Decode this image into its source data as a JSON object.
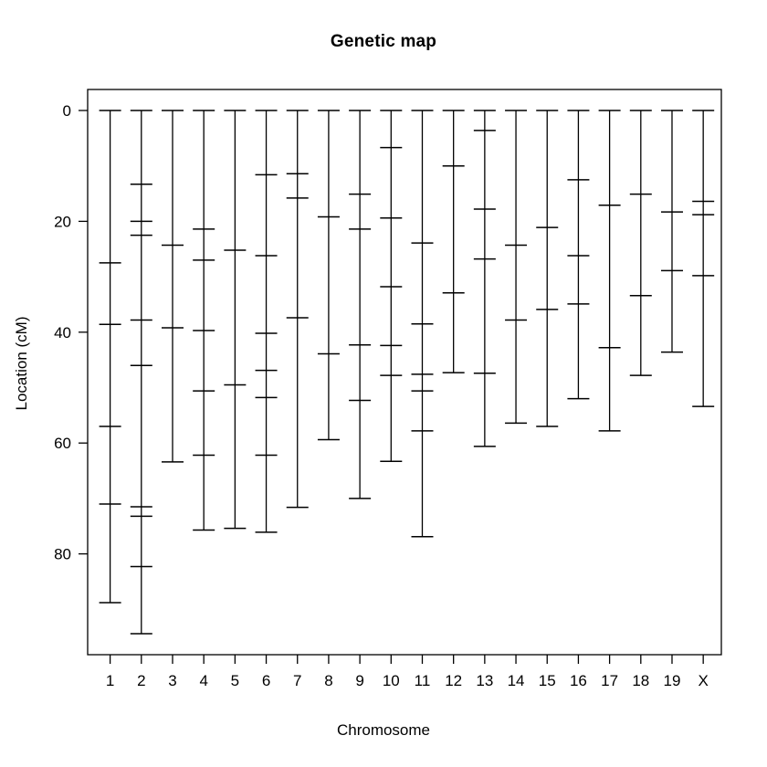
{
  "chart_data": {
    "type": "scatter",
    "title": "Genetic map",
    "xlabel": "Chromosome",
    "ylabel": "Location (cM)",
    "grid": false,
    "legend": null,
    "y_reversed": true,
    "ylim": [
      0,
      102
    ],
    "y_ticks": [
      0,
      20,
      40,
      60,
      80
    ],
    "y_tick_labels": [
      "0",
      "20",
      "40",
      "60",
      "80"
    ],
    "categories": [
      "1",
      "2",
      "3",
      "4",
      "5",
      "6",
      "7",
      "8",
      "9",
      "10",
      "11",
      "12",
      "13",
      "14",
      "15",
      "16",
      "17",
      "18",
      "19",
      "X"
    ],
    "series": [
      {
        "name": "1",
        "values": [
          0.0,
          27.5,
          38.6,
          57.0,
          71.0,
          88.8
        ]
      },
      {
        "name": "2",
        "values": [
          0.0,
          13.3,
          20.0,
          22.5,
          37.8,
          46.0,
          71.5,
          73.2,
          82.3,
          94.4
        ]
      },
      {
        "name": "3",
        "values": [
          0.0,
          24.3,
          39.2,
          63.4
        ]
      },
      {
        "name": "4",
        "values": [
          0.0,
          21.4,
          27.0,
          39.7,
          50.6,
          62.2,
          75.7
        ]
      },
      {
        "name": "5",
        "values": [
          0.0,
          25.2,
          49.5,
          75.4
        ]
      },
      {
        "name": "6",
        "values": [
          0.0,
          11.6,
          26.2,
          40.2,
          46.9,
          51.8,
          62.2,
          76.1
        ]
      },
      {
        "name": "7",
        "values": [
          0.0,
          11.4,
          15.8,
          37.4,
          71.6
        ]
      },
      {
        "name": "8",
        "values": [
          0.0,
          19.2,
          43.9,
          59.4
        ]
      },
      {
        "name": "9",
        "values": [
          0.0,
          15.1,
          21.4,
          42.3,
          52.3,
          70.0
        ]
      },
      {
        "name": "10",
        "values": [
          0.0,
          6.7,
          19.4,
          31.8,
          42.4,
          47.8,
          63.3
        ]
      },
      {
        "name": "11",
        "values": [
          0.0,
          23.9,
          38.5,
          47.6,
          50.6,
          57.8,
          76.9
        ]
      },
      {
        "name": "12",
        "values": [
          0.0,
          10.0,
          32.9,
          47.3
        ]
      },
      {
        "name": "13",
        "values": [
          0.0,
          3.6,
          17.8,
          26.8,
          47.4,
          60.6
        ]
      },
      {
        "name": "14",
        "values": [
          0.0,
          24.3,
          37.8,
          56.4
        ]
      },
      {
        "name": "15",
        "values": [
          0.0,
          21.1,
          35.9,
          57.0
        ]
      },
      {
        "name": "16",
        "values": [
          0.0,
          12.5,
          26.2,
          34.9,
          52.0
        ]
      },
      {
        "name": "17",
        "values": [
          0.0,
          17.1,
          42.8,
          57.8
        ]
      },
      {
        "name": "18",
        "values": [
          0.0,
          15.1,
          33.4,
          47.8
        ]
      },
      {
        "name": "19",
        "values": [
          0.0,
          18.3,
          28.9,
          43.6
        ]
      },
      {
        "name": "X",
        "values": [
          0.0,
          16.4,
          18.8,
          29.8,
          53.4
        ]
      }
    ]
  },
  "colors": {
    "line": "#000000",
    "background": "#ffffff",
    "text": "#000000"
  }
}
